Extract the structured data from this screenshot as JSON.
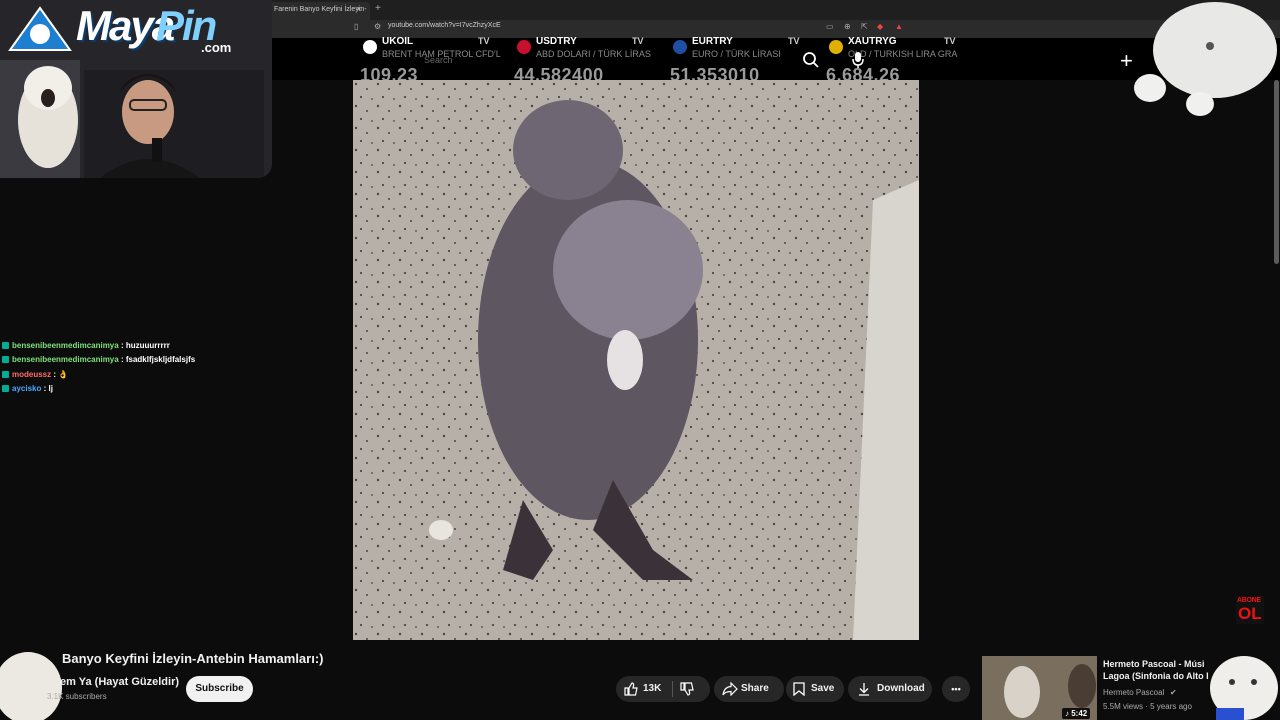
{
  "browser": {
    "tab_title": "Farenin Banyo Keyfini İzleyin-",
    "tab_close": "×",
    "new_tab": "+",
    "url": "youtube.com/watch?v=I7vcZhzyXcE"
  },
  "ticker": [
    {
      "symbol": "UKOIL",
      "desc": "BRENT HAM PETROL CFD'L",
      "value": "109.23",
      "flag_color": "#ffffff"
    },
    {
      "symbol": "USDTRY",
      "desc": "ABD DOLARI / TÜRK LİRAS",
      "value": "44.582400",
      "flag_color": "#c8102e"
    },
    {
      "symbol": "EURTRY",
      "desc": "EURO / TÜRK LİRASI",
      "value": "51.353010",
      "flag_color": "#1e4fa3"
    },
    {
      "symbol": "XAUTRYG",
      "desc": "OLD / TURKISH LIRA GRA",
      "value": "6,684.26",
      "flag_color": "#e0b000"
    }
  ],
  "ticker_tv_label": "TV",
  "search": {
    "placeholder": "Search"
  },
  "logo": {
    "maya": "Maya",
    "pin": "Pin",
    "com": ".com"
  },
  "chat": [
    {
      "user": "bensenibeenmedimcanimya",
      "message": " : huzuuurrrrr",
      "color": "#7fe07f"
    },
    {
      "user": "bensenibeenmedimcanimya",
      "message": " : fsadklfjskljdfalsjfs",
      "color": "#7fe07f"
    },
    {
      "user": "modeussz",
      "message": " : 👌",
      "color": "#ff6b6b"
    },
    {
      "user": "aycisko",
      "message": " : lj",
      "color": "#4aa8ff"
    }
  ],
  "video": {
    "title": "Banyo Keyfini İzleyin-Antebin Hamamları:)",
    "channel": "em Ya (Hayat Güzeldir)",
    "subscribers": "3.1K subscribers",
    "subscribe_label": "Subscribe",
    "likes": "13K",
    "share_label": "Share",
    "save_label": "Save",
    "download_label": "Download",
    "more_label": "•••"
  },
  "recommended": {
    "title": "Hermeto Pascoal - Músi Lagoa (Sinfonia do Alto I",
    "channel": "Hermeto Pascoal",
    "meta": "5.5M views · 5 years ago",
    "duration": "♪ 5:42"
  },
  "overlay": {
    "plus": "+",
    "abone_top": "ABONE",
    "abone_bottom": "OL"
  }
}
